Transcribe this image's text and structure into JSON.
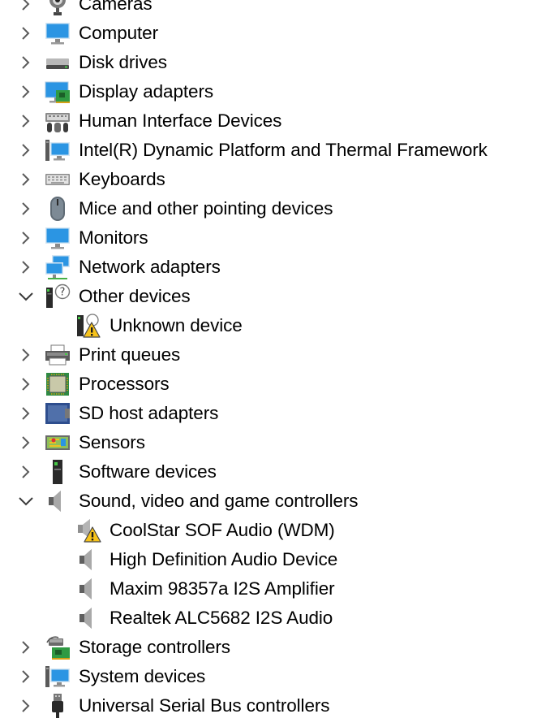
{
  "colors": {
    "chevron": "#5a5a5a",
    "text": "#000000",
    "monitor_blue": "#1e90e0",
    "warning_yellow": "#f7c31b"
  },
  "items": [
    {
      "label": "Cameras",
      "icon": "camera-icon",
      "expanded": false,
      "level": 0
    },
    {
      "label": "Computer",
      "icon": "monitor-icon",
      "expanded": false,
      "level": 0
    },
    {
      "label": "Disk drives",
      "icon": "disk-drive-icon",
      "expanded": false,
      "level": 0
    },
    {
      "label": "Display adapters",
      "icon": "display-adapter-icon",
      "expanded": false,
      "level": 0
    },
    {
      "label": "Human Interface Devices",
      "icon": "hid-icon",
      "expanded": false,
      "level": 0
    },
    {
      "label": "Intel(R) Dynamic Platform and Thermal Framework",
      "icon": "system-device-icon",
      "expanded": false,
      "level": 0
    },
    {
      "label": "Keyboards",
      "icon": "keyboard-icon",
      "expanded": false,
      "level": 0
    },
    {
      "label": "Mice and other pointing devices",
      "icon": "mouse-icon",
      "expanded": false,
      "level": 0
    },
    {
      "label": "Monitors",
      "icon": "monitor-icon",
      "expanded": false,
      "level": 0
    },
    {
      "label": "Network adapters",
      "icon": "network-adapter-icon",
      "expanded": false,
      "level": 0
    },
    {
      "label": "Other devices",
      "icon": "other-devices-icon",
      "expanded": true,
      "level": 0
    },
    {
      "label": "Unknown device",
      "icon": "unknown-device-warning-icon",
      "level": 1
    },
    {
      "label": "Print queues",
      "icon": "printer-icon",
      "expanded": false,
      "level": 0
    },
    {
      "label": "Processors",
      "icon": "processor-icon",
      "expanded": false,
      "level": 0
    },
    {
      "label": "SD host adapters",
      "icon": "sd-host-adapter-icon",
      "expanded": false,
      "level": 0
    },
    {
      "label": "Sensors",
      "icon": "sensor-icon",
      "expanded": false,
      "level": 0
    },
    {
      "label": "Software devices",
      "icon": "software-device-icon",
      "expanded": false,
      "level": 0
    },
    {
      "label": "Sound, video and game controllers",
      "icon": "speaker-icon",
      "expanded": true,
      "level": 0
    },
    {
      "label": "CoolStar SOF Audio (WDM)",
      "icon": "speaker-warning-icon",
      "level": 1
    },
    {
      "label": "High Definition Audio Device",
      "icon": "speaker-icon",
      "level": 1
    },
    {
      "label": "Maxim 98357a I2S Amplifier",
      "icon": "speaker-icon",
      "level": 1
    },
    {
      "label": "Realtek ALC5682 I2S Audio",
      "icon": "speaker-icon",
      "level": 1
    },
    {
      "label": "Storage controllers",
      "icon": "storage-controller-icon",
      "expanded": false,
      "level": 0
    },
    {
      "label": "System devices",
      "icon": "system-device-icon",
      "expanded": false,
      "level": 0
    },
    {
      "label": "Universal Serial Bus controllers",
      "icon": "usb-icon",
      "expanded": false,
      "level": 0
    }
  ]
}
